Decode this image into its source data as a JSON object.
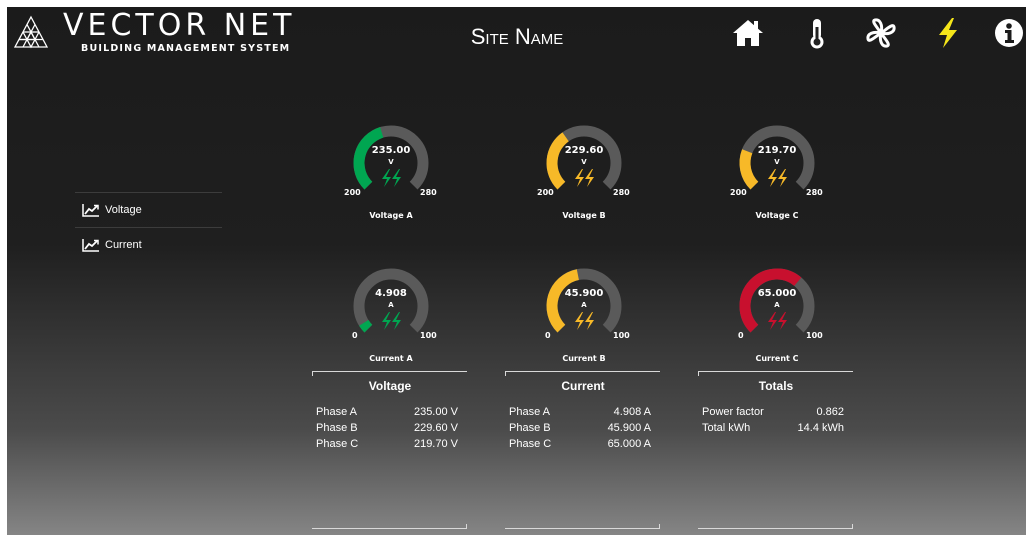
{
  "header": {
    "brand": "VECTOR NET",
    "brand_sub": "BUILDING MANAGEMENT SYSTEM",
    "site_name": "Site Name",
    "nav": [
      {
        "icon": "home-icon",
        "color": "#ffffff"
      },
      {
        "icon": "thermometer-icon",
        "color": "#ffffff"
      },
      {
        "icon": "fan-icon",
        "color": "#ffffff"
      },
      {
        "icon": "bolt-icon",
        "color": "#f5e61a"
      },
      {
        "icon": "info-icon",
        "color": "#ffffff"
      }
    ]
  },
  "sidebar": {
    "items": [
      {
        "label": "Voltage",
        "icon": "chart-line-icon"
      },
      {
        "label": "Current",
        "icon": "chart-line-icon"
      }
    ]
  },
  "colors": {
    "green": "#00a651",
    "amber": "#f7b928",
    "red": "#c8102e",
    "track": "#5a5a5a"
  },
  "gauges": [
    {
      "label": "Voltage A",
      "value": "235.00",
      "num": 235.0,
      "unit": "V",
      "min": "200",
      "max": "280",
      "minv": 200,
      "maxv": 280,
      "color": "#00a651"
    },
    {
      "label": "Voltage B",
      "value": "229.60",
      "num": 229.6,
      "unit": "V",
      "min": "200",
      "max": "280",
      "minv": 200,
      "maxv": 280,
      "color": "#f7b928"
    },
    {
      "label": "Voltage C",
      "value": "219.70",
      "num": 219.7,
      "unit": "V",
      "min": "200",
      "max": "280",
      "minv": 200,
      "maxv": 280,
      "color": "#f7b928"
    },
    {
      "label": "Current A",
      "value": "4.908",
      "num": 4.908,
      "unit": "A",
      "min": "0",
      "max": "100",
      "minv": 0,
      "maxv": 100,
      "color": "#00a651"
    },
    {
      "label": "Current B",
      "value": "45.900",
      "num": 45.9,
      "unit": "A",
      "min": "0",
      "max": "100",
      "minv": 0,
      "maxv": 100,
      "color": "#f7b928"
    },
    {
      "label": "Current C",
      "value": "65.000",
      "num": 65.0,
      "unit": "A",
      "min": "0",
      "max": "100",
      "minv": 0,
      "maxv": 100,
      "color": "#c8102e"
    }
  ],
  "panels": [
    {
      "title": "Voltage",
      "rows": [
        {
          "k": "Phase A",
          "v": "235.00 V"
        },
        {
          "k": "Phase B",
          "v": "229.60 V"
        },
        {
          "k": "Phase C",
          "v": "219.70 V"
        }
      ]
    },
    {
      "title": "Current",
      "rows": [
        {
          "k": "Phase A",
          "v": "4.908 A"
        },
        {
          "k": "Phase B",
          "v": "45.900 A"
        },
        {
          "k": "Phase C",
          "v": "65.000 A"
        }
      ]
    },
    {
      "title": "Totals",
      "rows": [
        {
          "k": "Power factor",
          "v": "0.862"
        },
        {
          "k": "Total kWh",
          "v": "14.4 kWh"
        }
      ]
    }
  ]
}
